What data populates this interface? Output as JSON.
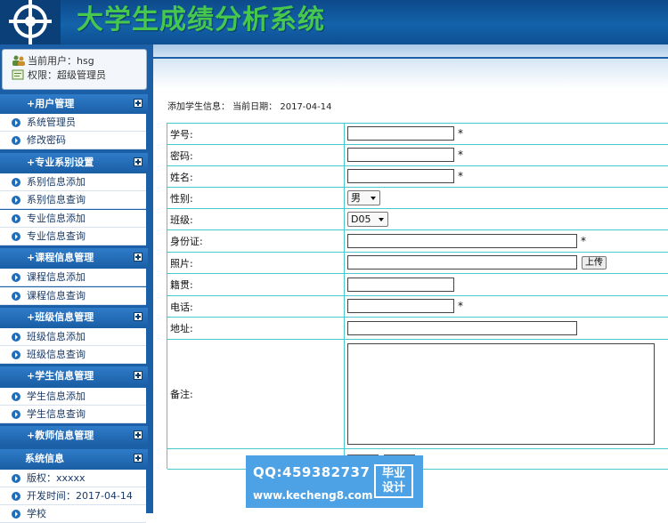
{
  "header": {
    "title": "大学生成绩分析系统"
  },
  "user_panel": {
    "current_user": "当前用户：hsg",
    "role": "权限：超级管理员"
  },
  "menu": [
    {
      "title": "+用户管理",
      "items": [
        "系统管理员",
        "修改密码"
      ]
    },
    {
      "title": "+专业系别设置",
      "items": [
        "系别信息添加",
        "系别信息查询",
        "专业信息添加",
        "专业信息查询"
      ]
    },
    {
      "title": "+课程信息管理",
      "items": [
        "课程信息添加",
        "课程信息查询"
      ]
    },
    {
      "title": "+班级信息管理",
      "items": [
        "班级信息添加",
        "班级信息查询"
      ]
    },
    {
      "title": "+学生信息管理",
      "items": [
        "学生信息添加",
        "学生信息查询"
      ]
    },
    {
      "title": "+教师信息管理",
      "items": []
    },
    {
      "title": "系统信息",
      "items": [
        "版权：xxxxx",
        "开发时间：2017-04-14",
        "学校"
      ]
    }
  ],
  "form": {
    "heading": "添加学生信息：  当前日期：  2017-04-14",
    "required_mark": "*",
    "labels": {
      "xuehao": "学号:",
      "mima": "密码:",
      "xingming": "姓名:",
      "xingbie": "性别:",
      "banji": "班级:",
      "shenfenzheng": "身份证:",
      "zhaopian": "照片:",
      "jiguan": "籍贯:",
      "dianhua": "电话:",
      "dizhi": "地址:",
      "beizhu": "备注:"
    },
    "values": {
      "xuehao": "",
      "mima": "",
      "xingming": "",
      "shenfenzheng": "",
      "zhaopian": "",
      "jiguan": "",
      "dianhua": "",
      "dizhi": "",
      "beizhu": ""
    },
    "gender_selected": "男",
    "class_selected": "D05",
    "upload_label": "上传"
  },
  "watermark": {
    "qq": "QQ:459382737",
    "url": "www.kecheng8.com",
    "badge_line1": "毕业",
    "badge_line2": "设计"
  },
  "colors": {
    "header_bg": "#1363ab",
    "title_green": "#46c84e",
    "sidebar_bg": "#1b5fa6",
    "table_border": "#48c9cc",
    "watermark_bg": "#4da2e6"
  }
}
